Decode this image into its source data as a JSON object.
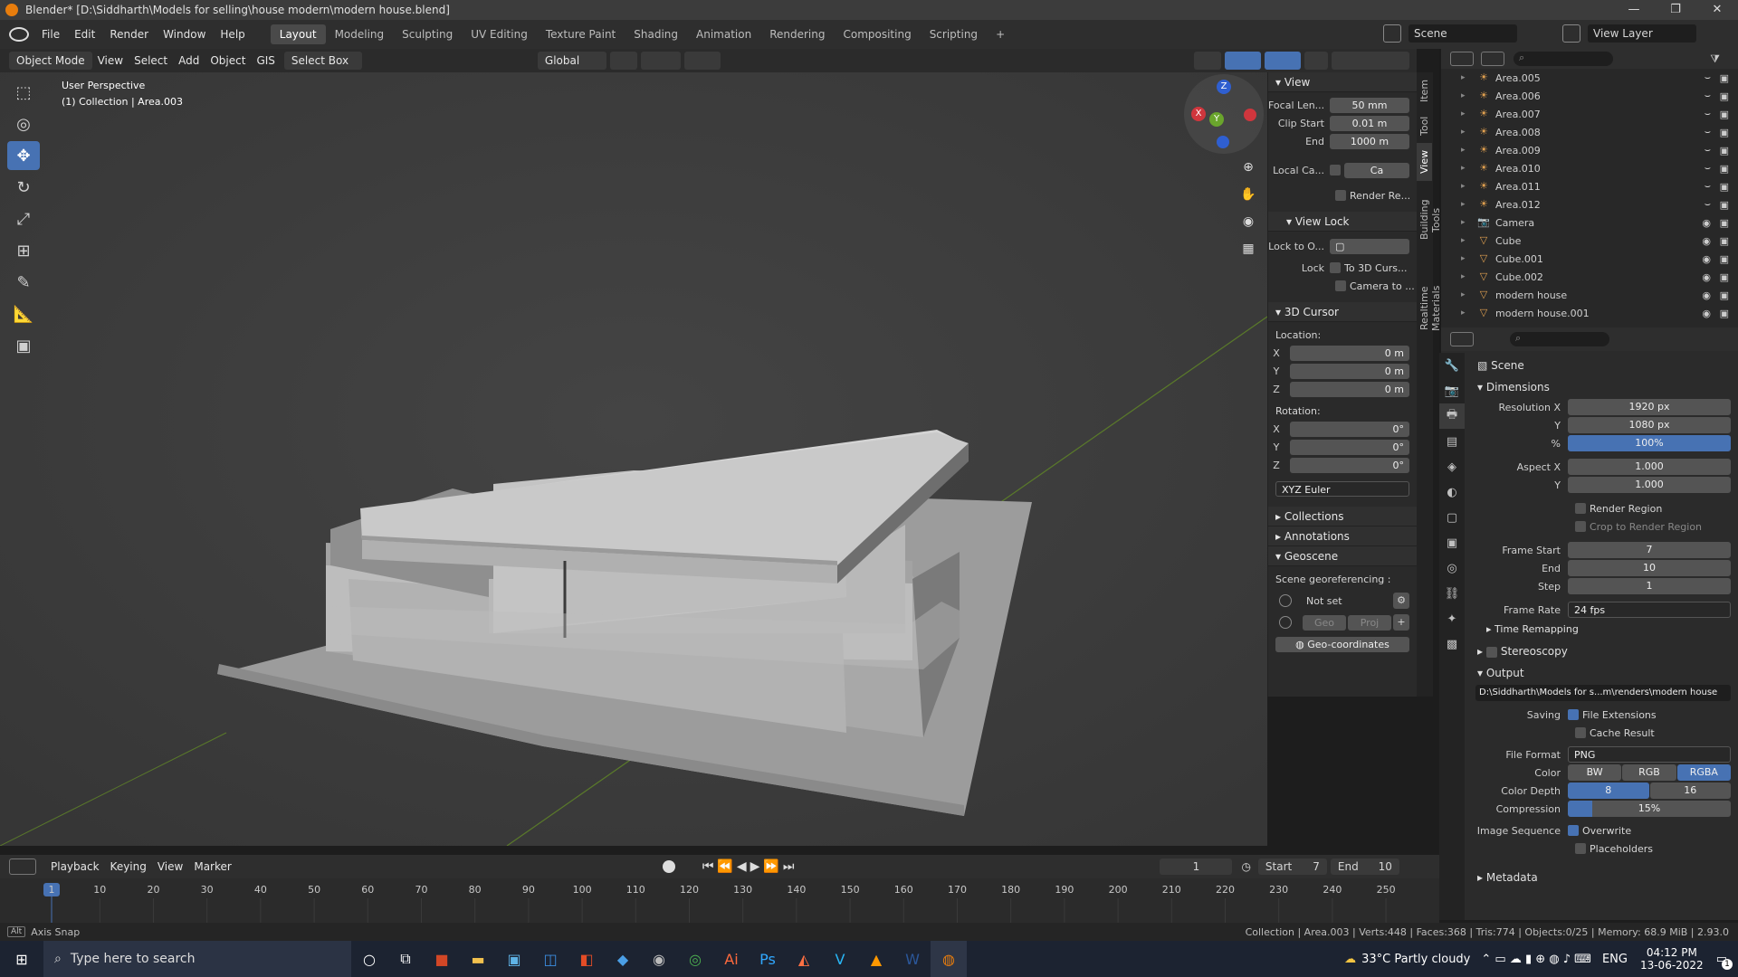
{
  "window": {
    "title": "Blender* [D:\\Siddharth\\Models for selling\\house modern\\modern house.blend]",
    "minimize": "—",
    "maximize": "❐",
    "close": "✕"
  },
  "menu": [
    "File",
    "Edit",
    "Render",
    "Window",
    "Help"
  ],
  "workspaces": [
    "Layout",
    "Modeling",
    "Sculpting",
    "UV Editing",
    "Texture Paint",
    "Shading",
    "Animation",
    "Rendering",
    "Compositing",
    "Scripting"
  ],
  "workspace_add": "+",
  "scene_name": "Scene",
  "view_layer": "View Layer",
  "header3d": {
    "mode": "Object Mode",
    "view": "View",
    "select": "Select",
    "add": "Add",
    "object": "Object",
    "gis": "GIS",
    "select_box": "Select Box",
    "orientation": "Global"
  },
  "viewport": {
    "perspective": "User Perspective",
    "collection": "(1) Collection | Area.003"
  },
  "gizmo": {
    "x": "X",
    "y": "Y",
    "z": "Z"
  },
  "npanel": {
    "tabs": [
      "Item",
      "Tool",
      "View",
      "Building Tools",
      "Realtime Materials"
    ],
    "view_title": "View",
    "focal_label": "Focal Len...",
    "focal_value": "50 mm",
    "clip_start_label": "Clip Start",
    "clip_start_value": "0.01 m",
    "end_label": "End",
    "end_value": "1000 m",
    "local_cam_label": "Local Ca...",
    "local_cam_value": "Ca",
    "render_region": "Render Re...",
    "view_lock_title": "View Lock",
    "lock_to_label": "Lock to O...",
    "lock_label": "Lock",
    "lock_3d_cursor": "To 3D Curs...",
    "camera_to": "Camera to ...",
    "cursor_title": "3D Cursor",
    "location_label": "Location:",
    "loc": [
      {
        "axis": "X",
        "value": "0 m"
      },
      {
        "axis": "Y",
        "value": "0 m"
      },
      {
        "axis": "Z",
        "value": "0 m"
      }
    ],
    "rotation_label": "Rotation:",
    "rot": [
      {
        "axis": "X",
        "value": "0°"
      },
      {
        "axis": "Y",
        "value": "0°"
      },
      {
        "axis": "Z",
        "value": "0°"
      }
    ],
    "rotation_mode": "XYZ Euler",
    "collections": "Collections",
    "annotations": "Annotations",
    "geoscene": "Geoscene",
    "georef_label": "Scene georeferencing :",
    "not_set": "Not set",
    "geo": "Geo",
    "proj": "Proj",
    "geo_coords": "Geo-coordinates"
  },
  "outliner": {
    "items": [
      {
        "name": "Area.005",
        "type": "light"
      },
      {
        "name": "Area.006",
        "type": "light"
      },
      {
        "name": "Area.007",
        "type": "light"
      },
      {
        "name": "Area.008",
        "type": "light"
      },
      {
        "name": "Area.009",
        "type": "light"
      },
      {
        "name": "Area.010",
        "type": "light"
      },
      {
        "name": "Area.011",
        "type": "light"
      },
      {
        "name": "Area.012",
        "type": "light"
      },
      {
        "name": "Camera",
        "type": "camera"
      },
      {
        "name": "Cube",
        "type": "mesh"
      },
      {
        "name": "Cube.001",
        "type": "mesh"
      },
      {
        "name": "Cube.002",
        "type": "mesh"
      },
      {
        "name": "modern house",
        "type": "mesh"
      },
      {
        "name": "modern house.001",
        "type": "mesh"
      }
    ]
  },
  "props": {
    "scene": "Scene",
    "dimensions": "Dimensions",
    "res_x_label": "Resolution X",
    "res_x": "1920 px",
    "res_y_label": "Y",
    "res_y": "1080 px",
    "pct_label": "%",
    "pct": "100%",
    "aspect_x_label": "Aspect X",
    "aspect_x": "1.000",
    "aspect_y_label": "Y",
    "aspect_y": "1.000",
    "render_region": "Render Region",
    "crop_region": "Crop to Render Region",
    "frame_start_label": "Frame Start",
    "frame_start": "7",
    "frame_end_label": "End",
    "frame_end": "10",
    "step_label": "Step",
    "step": "1",
    "frame_rate_label": "Frame Rate",
    "frame_rate": "24 fps",
    "time_remap": "Time Remapping",
    "stereoscopy": "Stereoscopy",
    "output": "Output",
    "output_path": "D:\\Siddharth\\Models for s...m\\renders\\modern house",
    "saving_label": "Saving",
    "file_ext": "File Extensions",
    "cache_result": "Cache Result",
    "file_format_label": "File Format",
    "file_format": "PNG",
    "color_label": "Color",
    "color_bw": "BW",
    "color_rgb": "RGB",
    "color_rgba": "RGBA",
    "depth_label": "Color Depth",
    "depth_8": "8",
    "depth_16": "16",
    "compression_label": "Compression",
    "compression": "15%",
    "compression_fraction": 0.15,
    "imgseq_label": "Image Sequence",
    "overwrite": "Overwrite",
    "placeholders": "Placeholders",
    "metadata": "Metadata"
  },
  "timeline": {
    "playback": "Playback",
    "keying": "Keying",
    "view": "View",
    "marker": "Marker",
    "current_frame": "1",
    "start_label": "Start",
    "start": "7",
    "end_label": "End",
    "end": "10",
    "ticks": [
      "1",
      "10",
      "20",
      "30",
      "40",
      "50",
      "60",
      "70",
      "80",
      "90",
      "100",
      "110",
      "120",
      "130",
      "140",
      "150",
      "160",
      "170",
      "180",
      "190",
      "200",
      "210",
      "220",
      "230",
      "240",
      "250"
    ]
  },
  "status": {
    "hint": "Axis Snap",
    "hint_key": "Alt",
    "stats": "Collection | Area.003 | Verts:448 | Faces:368 | Tris:774 | Objects:0/25 | Memory: 68.9 MiB | 2.93.0"
  },
  "taskbar": {
    "search": "Type here to search",
    "weather": "33°C  Partly cloudy",
    "lang": "ENG",
    "time": "04:12 PM",
    "date": "13-06-2022",
    "notif": "1"
  }
}
